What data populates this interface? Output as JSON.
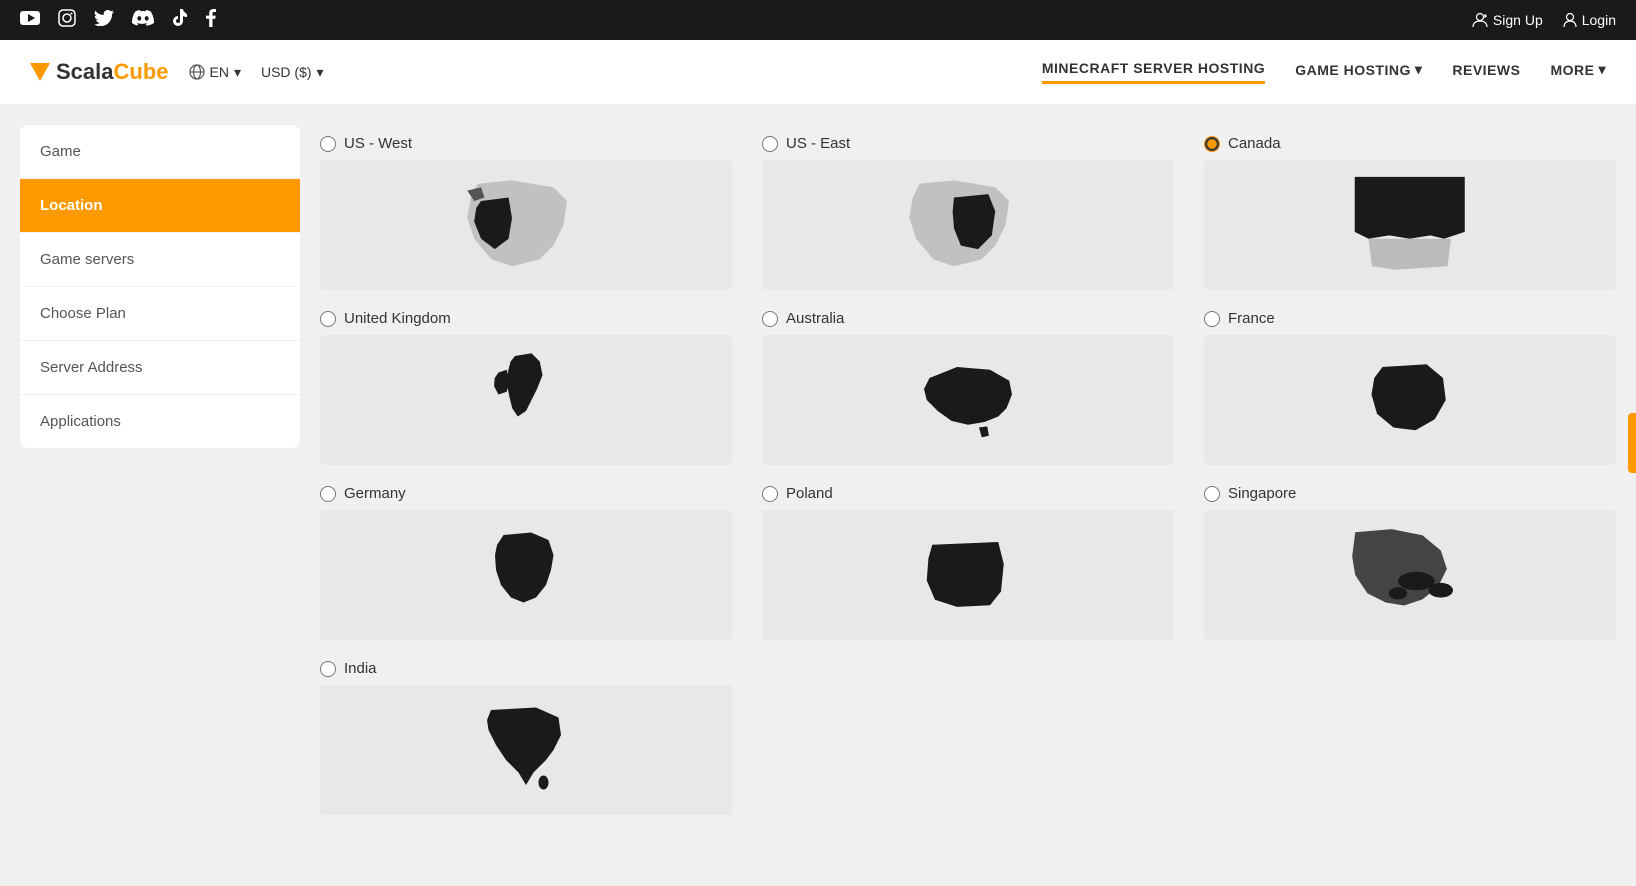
{
  "social_bar": {
    "icons": [
      "youtube",
      "instagram",
      "twitter",
      "discord",
      "tiktok",
      "facebook"
    ],
    "auth": {
      "signup": "Sign Up",
      "login": "Login"
    }
  },
  "nav": {
    "logo": {
      "scala": "Scala",
      "cube": "Cube"
    },
    "lang": "EN",
    "currency": "USD ($)",
    "links": [
      {
        "label": "MINECRAFT SERVER HOSTING",
        "active": true
      },
      {
        "label": "GAME HOSTING",
        "has_arrow": true,
        "active": false
      },
      {
        "label": "REVIEWS",
        "active": false
      },
      {
        "label": "MORE",
        "has_arrow": true,
        "active": false
      }
    ]
  },
  "sidebar": {
    "items": [
      {
        "label": "Game",
        "active": false
      },
      {
        "label": "Location",
        "active": true
      },
      {
        "label": "Game servers",
        "active": false
      },
      {
        "label": "Choose Plan",
        "active": false
      },
      {
        "label": "Server Address",
        "active": false
      },
      {
        "label": "Applications",
        "active": false
      }
    ]
  },
  "locations": [
    {
      "id": "us-west",
      "label": "US - West",
      "selected": false
    },
    {
      "id": "us-east",
      "label": "US - East",
      "selected": false
    },
    {
      "id": "canada",
      "label": "Canada",
      "selected": true
    },
    {
      "id": "uk",
      "label": "United Kingdom",
      "selected": false
    },
    {
      "id": "australia",
      "label": "Australia",
      "selected": false
    },
    {
      "id": "france",
      "label": "France",
      "selected": false
    },
    {
      "id": "germany",
      "label": "Germany",
      "selected": false
    },
    {
      "id": "poland",
      "label": "Poland",
      "selected": false
    },
    {
      "id": "singapore",
      "label": "Singapore",
      "selected": false
    },
    {
      "id": "india",
      "label": "India",
      "selected": false
    }
  ]
}
